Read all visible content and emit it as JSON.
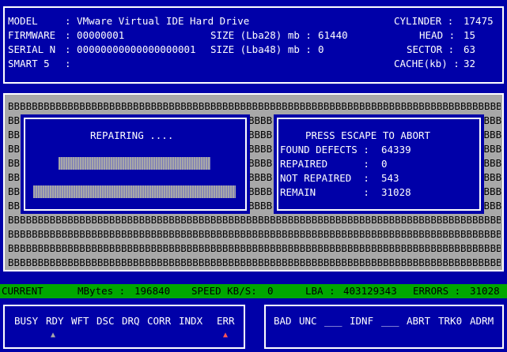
{
  "header": {
    "model_label": "MODEL",
    "model_value": ": VMware Virtual IDE Hard Drive",
    "firmware_label": "FIRMWARE",
    "firmware_value": ": 00000001",
    "serial_label": "SERIAL N",
    "serial_value": ": 00000000000000000001",
    "smart_label": "SMART 5",
    "smart_value": ":",
    "size28_label": "SIZE (Lba28) mb :",
    "size28_value": "61440",
    "size48_label": "SIZE (Lba48) mb :",
    "size48_value": "0",
    "cylinder_label": "CYLINDER :",
    "cylinder_value": "17475",
    "head_label": "HEAD :",
    "head_value": "15",
    "sector_label": "SECTOR :",
    "sector_value": "63",
    "cache_label": "CACHE(kb) :",
    "cache_value": "32"
  },
  "grid": {
    "cell_text": "B",
    "full_line": "BBBBBBBBBBBBBBBBBBBBBBBBBBBBBBBBBBBBBBBBBBBBBBBBBBBBBBBBBBBBBBBBBBBBBBBBBBBBBBBBBBBBBBBBBBBB",
    "left_bits": "BB",
    "mid_bits": "BBBB",
    "right_bits": "BBBB",
    "last_line": "BBBBBBBBBBBBBBBBBBBBBBBBBBBBBBBBBBBBBBBBBBBBBBBBBBBBBBBBBBBBBBBBBBBBBBBBBBBBBBBBBBBBBBBBBB"
  },
  "repair_dialog": {
    "title": "REPAIRING ...."
  },
  "abort_dialog": {
    "title": "PRESS ESCAPE TO ABORT",
    "found_label": "FOUND DEFECTS :",
    "found_value": "64339",
    "repaired_label": "REPAIRED      :",
    "repaired_value": "0",
    "not_repaired_label": "NOT REPAIRED  :",
    "not_repaired_value": "543",
    "remain_label": "REMAIN        :",
    "remain_value": "31028"
  },
  "status": {
    "current_label": "CURRENT",
    "mbytes_label": "MBytes :",
    "mbytes_value": "196840",
    "speed_label": "SPEED KB/S:",
    "speed_value": "0",
    "lba_label": "LBA :",
    "lba_value": "403129343",
    "errors_label": "ERRORS :",
    "errors_value": "31028"
  },
  "ata_status": {
    "flags": [
      "BUSY",
      "RDY",
      "WFT",
      "DSC",
      "DRQ",
      "CORR",
      "INDX",
      "ERR"
    ],
    "rdy_marker": "▲",
    "err_marker": "▲"
  },
  "ata_errors": {
    "flags": [
      "BAD",
      "UNC",
      "___",
      "IDNF",
      "___",
      "ABRT",
      "TRK0",
      "ADRM"
    ]
  },
  "colors": {
    "background": "#0000a8",
    "grid": "#a8a8a8",
    "status_bar": "#00a800",
    "rdy_marker": "#a8a8a8",
    "err_marker": "#ff5555"
  }
}
